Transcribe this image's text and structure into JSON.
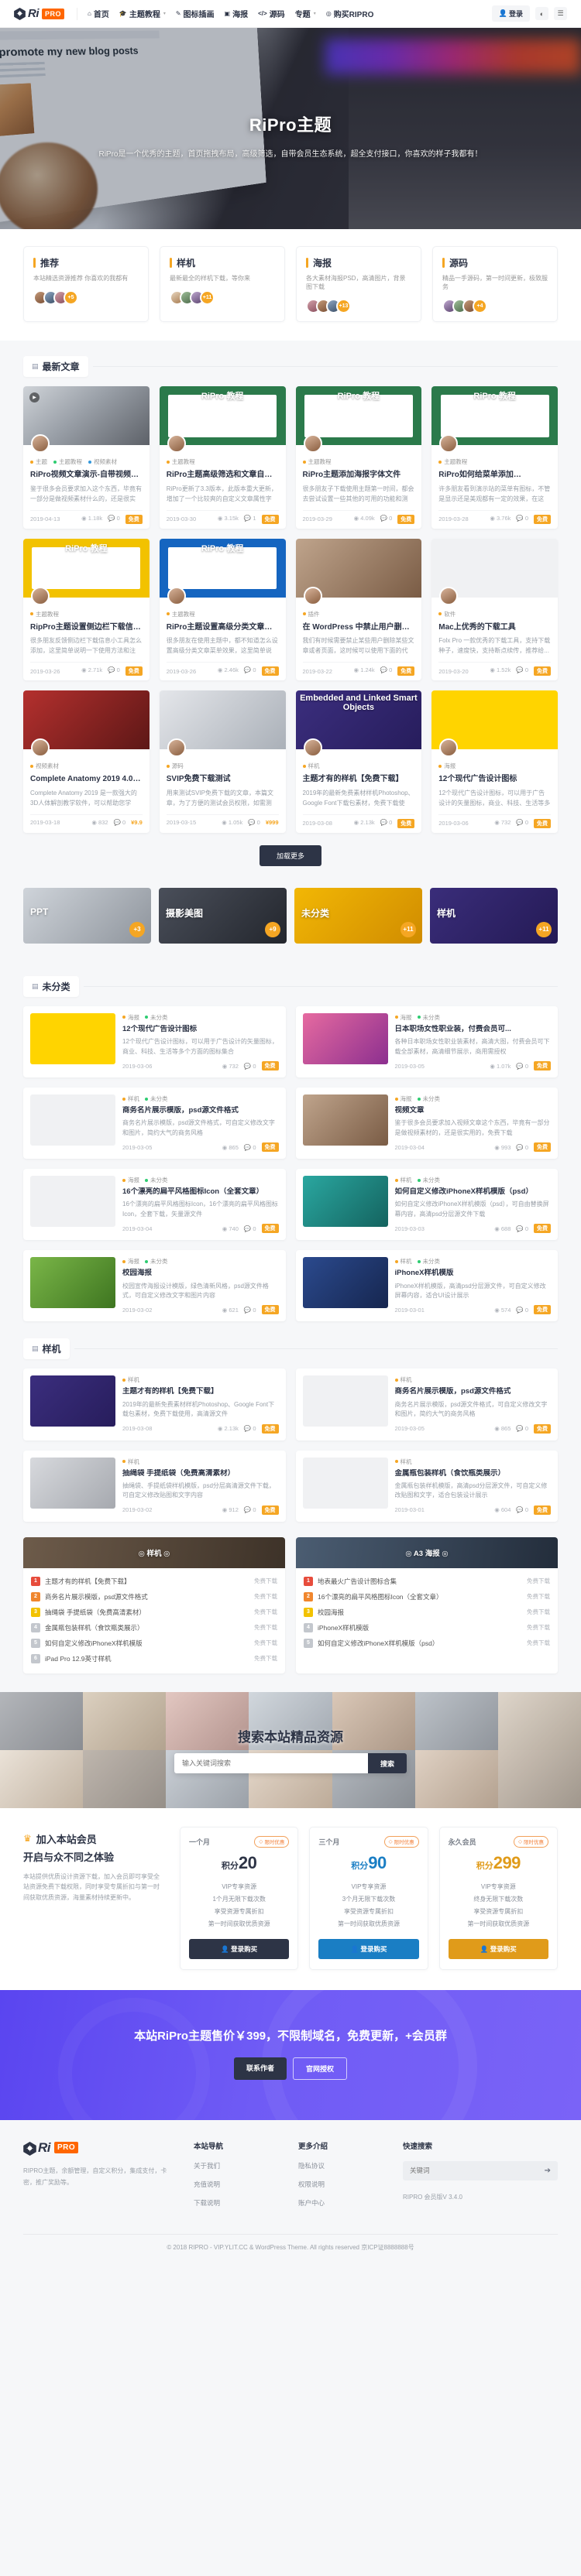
{
  "header": {
    "logo": {
      "ri": "Ri",
      "pro": "PRO",
      "icon": "diamond-logo-icon"
    },
    "nav": [
      {
        "label": "首页",
        "icon": "home-icon",
        "caret": false
      },
      {
        "label": "主题教程",
        "icon": "graduation-icon",
        "caret": true
      },
      {
        "label": "图标插画",
        "icon": "pen-icon",
        "caret": false
      },
      {
        "label": "海报",
        "icon": "image-icon",
        "caret": false
      },
      {
        "label": "源码",
        "icon": "code-icon",
        "caret": false
      },
      {
        "label": "专题",
        "icon": "",
        "caret": true
      },
      {
        "label": "购买RIPRO",
        "icon": "cart-icon",
        "caret": false
      }
    ],
    "login_label": "登录",
    "login_icon": "user-icon",
    "theme_icon": "contrast-icon",
    "menu_icon": "hamburger-icon"
  },
  "hero": {
    "title": "RiPro主题",
    "subtitle": "RiPro是一个优秀的主题，首页拖拽布局，高级筛选，自带会员生态系统，超全支付接口，你喜欢的样子我都有！",
    "screen_text": "How I promote my new blog posts"
  },
  "categories": [
    {
      "title": "推荐",
      "desc": "本站精选资源推荐 你喜欢的我都有",
      "more": "+5"
    },
    {
      "title": "样机",
      "desc": "最新最全的样机下载，等你来",
      "more": "+11"
    },
    {
      "title": "海报",
      "desc": "各大素材海报PSD，高清图片，背景图下载",
      "more": "+13"
    },
    {
      "title": "源码",
      "desc": "精品一手源码，第一时间更新，极致服务",
      "more": "+4"
    }
  ],
  "latest": {
    "section_title": "最新文章",
    "section_icon": "grid-icon",
    "loadmore_label": "加载更多",
    "posts": [
      {
        "thumb": "th-girl",
        "thumb_label": "",
        "play": true,
        "cats": [
          {
            "label": "主题",
            "color": "#f5a623"
          },
          {
            "label": "主题教程",
            "color": "#2ecc71"
          },
          {
            "label": "视频素材",
            "color": "#3498db"
          }
        ],
        "title": "RiPro视频文章演示-自带视频播放...",
        "excerpt": "鉴于很多会员要求加入这个东西，毕竟有一部分是做视频素材什么的，还是很实用...",
        "date": "2019-04-13",
        "views": "1.18k",
        "comments": "0",
        "price": "免费"
      },
      {
        "thumb": "th-ripro",
        "thumb_label": "RiPro 教程",
        "play": false,
        "cats": [
          {
            "label": "主题教程",
            "color": "#f5a623"
          }
        ],
        "title": "RiPro主题高级筛选和文章自定义属...",
        "excerpt": "RiPro更新了3.3版本，此版本重大更新，增加了一个比较爽的自定义文章属性字段...",
        "date": "2019-03-30",
        "views": "3.15k",
        "comments": "1",
        "price": "免费"
      },
      {
        "thumb": "th-ripro",
        "thumb_label": "RiPro 教程",
        "play": false,
        "cats": [
          {
            "label": "主题教程",
            "color": "#f5a623"
          }
        ],
        "title": "RiPro主题添加海报字体文件",
        "excerpt": "很多朋友子下载使用主题第一时间，都会去尝试设置一些其他的可用的功能和测试...",
        "date": "2019-03-29",
        "views": "4.09k",
        "comments": "0",
        "price": "免费"
      },
      {
        "thumb": "th-ripro",
        "thumb_label": "RiPro 教程",
        "play": false,
        "cats": [
          {
            "label": "主题教程",
            "color": "#f5a623"
          }
        ],
        "title": "RiPro如何给菜单添加fontaweso...",
        "excerpt": "许多朋友看到演示站的菜单有图标，不管是显示还是美观都有一定的效果，在这里...",
        "date": "2019-03-28",
        "views": "3.76k",
        "comments": "0",
        "price": "免费"
      },
      {
        "thumb": "th-ripro yellow",
        "thumb_label": "RiPro 教程",
        "play": false,
        "cats": [
          {
            "label": "主题教程",
            "color": "#f5a623"
          }
        ],
        "title": "RipPro主题设置侧边栏下载信息小...",
        "excerpt": "很多朋友反馈侧边栏下载信息小工具怎么添加，这里简单说明一下使用方法和注意...",
        "date": "2019-03-26",
        "views": "2.71k",
        "comments": "0",
        "price": "免费"
      },
      {
        "thumb": "th-ripro navy",
        "thumb_label": "RiPro 教程",
        "play": false,
        "cats": [
          {
            "label": "主题教程",
            "color": "#f5a623"
          }
        ],
        "title": "RiPro主题设置高级分类文章菜单",
        "excerpt": "很多朋友在使用主题中，都不知道怎么设置高级分类文章菜单效果，这里简单说明...",
        "date": "2019-03-26",
        "views": "2.46k",
        "comments": "0",
        "price": "免费"
      },
      {
        "thumb": "th-photo1",
        "thumb_label": "",
        "play": false,
        "cats": [
          {
            "label": "插件",
            "color": "#f5a623"
          }
        ],
        "title": "在 WordPress 中禁止用户删除某...",
        "excerpt": "我们有时候需要禁止某些用户删除某些文章或者页面，这时候可以使用下面的代码...",
        "date": "2019-03-22",
        "views": "1.24k",
        "comments": "0",
        "price": "免费"
      },
      {
        "thumb": "th-white",
        "thumb_label": "",
        "play": false,
        "cats": [
          {
            "label": "软件",
            "color": "#f5a623"
          }
        ],
        "title": "Mac上优秀的下载工具",
        "excerpt": "Folx Pro 一款优秀的下载工具，支持下载种子，速度快，支持断点续传，推荐给...",
        "date": "2019-03-20",
        "views": "1.52k",
        "comments": "0",
        "price": "免费"
      },
      {
        "thumb": "th-red",
        "thumb_label": "",
        "play": false,
        "cats": [
          {
            "label": "视频素材",
            "color": "#f5a623"
          }
        ],
        "title": "Complete Anatomy 2019 4.0.1 ...",
        "excerpt": "Complete Anatomy 2019 是一款强大的3D人体解剖教学软件，可以帮助您学习...",
        "date": "2019-03-18",
        "views": "832",
        "comments": "0",
        "price": "¥9.9"
      },
      {
        "thumb": "th-photo2",
        "thumb_label": "",
        "play": false,
        "cats": [
          {
            "label": "源码",
            "color": "#f5a623"
          }
        ],
        "title": "SVIP免费下载测试",
        "excerpt": "用来测试SVIP免费下载的文章，本篇文章，为了方便的测试会员权限，如需测试，请自行注册...",
        "date": "2019-03-15",
        "views": "1.05k",
        "comments": "0",
        "price": "¥999"
      },
      {
        "thumb": "th-purple",
        "thumb_label": "Embedded and Linked Smart Objects",
        "play": false,
        "cats": [
          {
            "label": "样机",
            "color": "#f5a623"
          }
        ],
        "title": "主题才有的样机【免费下载】",
        "excerpt": "2019年的最新免费素材样机Photoshop、Google Font下载包素材，免费下载使用...",
        "date": "2019-03-08",
        "views": "2.13k",
        "comments": "0",
        "price": "免费"
      },
      {
        "thumb": "th-yellowflat",
        "thumb_label": "",
        "play": false,
        "cats": [
          {
            "label": "海报",
            "color": "#f5a623"
          }
        ],
        "title": "12个现代广告设计图标",
        "excerpt": "12个现代广告设计图标，可以用于广告设计的矢量图标，商业、科技、生活等多个...",
        "date": "2019-03-06",
        "views": "732",
        "comments": "0",
        "price": "免费"
      }
    ]
  },
  "strip": [
    {
      "label": "PPT",
      "badge": "+3",
      "cls": "strip1"
    },
    {
      "label": "摄影美图",
      "badge": "+9",
      "cls": "strip2"
    },
    {
      "label": "未分类",
      "badge": "+11",
      "cls": "strip3"
    },
    {
      "label": "样机",
      "badge": "+11",
      "cls": "strip4"
    }
  ],
  "uncategorized": {
    "section_title": "未分类",
    "section_icon": "grid-icon",
    "items": [
      {
        "thumb": "th-yellowflat",
        "cats": [
          {
            "label": "海报",
            "color": "#f5a623"
          },
          {
            "label": "未分类",
            "color": "#2ecc71"
          }
        ],
        "title": "12个现代广告设计图标",
        "excerpt": "12个现代广告设计图标，可以用于广告设计的矢量图标，商业、科技、生活等多个方面的图标集合",
        "date": "2019-03-06",
        "views": "732",
        "comments": "0",
        "price": "免费"
      },
      {
        "thumb": "th-pink",
        "cats": [
          {
            "label": "海报",
            "color": "#f5a623"
          },
          {
            "label": "未分类",
            "color": "#2ecc71"
          }
        ],
        "title": "日本职场女性职业装，付费会员可...",
        "excerpt": "各种日本职场女性职业装素材，高清大图，付费会员可下载全部素材，高清细节展示，商用需授权",
        "date": "2019-03-05",
        "views": "1.07k",
        "comments": "0",
        "price": "免费"
      },
      {
        "thumb": "th-white",
        "cats": [
          {
            "label": "样机",
            "color": "#f5a623"
          },
          {
            "label": "未分类",
            "color": "#2ecc71"
          }
        ],
        "title": "商务名片展示模版，psd源文件格式",
        "excerpt": "商务名片展示模版，psd源文件格式，可自定义修改文字和图片，简约大气的商务风格",
        "date": "2019-03-05",
        "views": "865",
        "comments": "0",
        "price": "免费"
      },
      {
        "thumb": "th-photo1",
        "cats": [
          {
            "label": "海报",
            "color": "#f5a623"
          },
          {
            "label": "未分类",
            "color": "#2ecc71"
          }
        ],
        "title": "视频文章",
        "excerpt": "鉴于很多会员要求加入视频文章这个东西，毕竟有一部分是做视频素材的，还是很实用的，免费下载",
        "date": "2019-03-04",
        "views": "993",
        "comments": "0",
        "price": "免费"
      },
      {
        "thumb": "th-white",
        "cats": [
          {
            "label": "海报",
            "color": "#f5a623"
          },
          {
            "label": "未分类",
            "color": "#2ecc71"
          }
        ],
        "title": "16个漂亮的扁平风格图标Icon（全套文章）",
        "excerpt": "16个漂亮的扁平风格图标Icon，16个漂亮的扁平风格图标Icon，全套下载，矢量源文件",
        "date": "2019-03-04",
        "views": "740",
        "comments": "0",
        "price": "免费"
      },
      {
        "thumb": "th-teal",
        "cats": [
          {
            "label": "样机",
            "color": "#f5a623"
          },
          {
            "label": "未分类",
            "color": "#2ecc71"
          }
        ],
        "title": "如何自定义修改iPhoneX样机模版（psd）",
        "excerpt": "如何自定义修改iPhoneX样机模版（psd），可自由替换屏幕内容，高清psd分层源文件下载",
        "date": "2019-03-03",
        "views": "688",
        "comments": "0",
        "price": "免费"
      },
      {
        "thumb": "th-green2",
        "cats": [
          {
            "label": "海报",
            "color": "#f5a623"
          },
          {
            "label": "未分类",
            "color": "#2ecc71"
          }
        ],
        "title": "校园海报",
        "excerpt": "校园宣传海报设计模版，绿色清新风格，psd源文件格式，可自定义修改文字和图片内容",
        "date": "2019-03-02",
        "views": "621",
        "comments": "0",
        "price": "免费"
      },
      {
        "thumb": "th-blue2",
        "cats": [
          {
            "label": "样机",
            "color": "#f5a623"
          },
          {
            "label": "未分类",
            "color": "#2ecc71"
          }
        ],
        "title": "iPhoneX样机模版",
        "excerpt": "iPhoneX样机模版，高清psd分层源文件，可自定义修改屏幕内容，适合UI设计展示",
        "date": "2019-03-01",
        "views": "574",
        "comments": "0",
        "price": "免费"
      }
    ]
  },
  "mockups": {
    "section_title": "样机",
    "section_icon": "grid-icon",
    "items": [
      {
        "thumb": "th-purple",
        "cats": [
          {
            "label": "样机",
            "color": "#f5a623"
          }
        ],
        "title": "主题才有的样机【免费下载】",
        "excerpt": "2019年的最新免费素材样机Photoshop、Google Font下载包素材，免费下载使用，高清源文件",
        "date": "2019-03-08",
        "views": "2.13k",
        "comments": "0",
        "price": "免费"
      },
      {
        "thumb": "th-white",
        "cats": [
          {
            "label": "样机",
            "color": "#f5a623"
          }
        ],
        "title": "商务名片展示模版，psd源文件格式",
        "excerpt": "商务名片展示模版，psd源文件格式，可自定义修改文字和图片，简约大气的商务风格",
        "date": "2019-03-05",
        "views": "865",
        "comments": "0",
        "price": "免费"
      },
      {
        "thumb": "th-grey",
        "cats": [
          {
            "label": "样机",
            "color": "#f5a623"
          }
        ],
        "title": "抽绳袋 手提纸袋（免费高清素材）",
        "excerpt": "抽绳袋、手提纸袋样机模版，psd分层高清源文件下载，可自定义修改贴图和文字内容",
        "date": "2019-03-02",
        "views": "912",
        "comments": "0",
        "price": "免费"
      },
      {
        "thumb": "th-white",
        "cats": [
          {
            "label": "样机",
            "color": "#f5a623"
          }
        ],
        "title": "金属瓶包装样机（食饮瓶类展示）",
        "excerpt": "金属瓶包装样机模版，高清psd分层源文件，可自定义修改贴图和文字，适合包装设计展示",
        "date": "2019-03-01",
        "views": "604",
        "comments": "0",
        "price": "免费"
      }
    ]
  },
  "ranks": [
    {
      "title": "◎ 样机 ◎",
      "head_cls": "rh1",
      "items": [
        {
          "n": "1",
          "name": "主题才有的样机【免费下载】",
          "val": "免费下载"
        },
        {
          "n": "2",
          "name": "商务名片展示模版，psd源文件格式",
          "val": "免费下载"
        },
        {
          "n": "3",
          "name": "抽绳袋 手提纸袋（免费高清素材）",
          "val": "免费下载"
        },
        {
          "n": "4",
          "name": "金属瓶包装样机（食饮瓶类展示）",
          "val": "免费下载"
        },
        {
          "n": "5",
          "name": "如何自定义修改iPhoneX样机模版",
          "val": "免费下载"
        },
        {
          "n": "6",
          "name": "iPad Pro 12.9英寸样机",
          "val": "免费下载"
        }
      ]
    },
    {
      "title": "◎ A3 海报 ◎",
      "head_cls": "rh2",
      "items": [
        {
          "n": "1",
          "name": "地表最火广告设计图标合集",
          "val": "免费下载"
        },
        {
          "n": "2",
          "name": "16个漂亮的扁平风格图标Icon（全套文章）",
          "val": "免费下载"
        },
        {
          "n": "3",
          "name": "校园海报",
          "val": "免费下载"
        },
        {
          "n": "4",
          "name": "iPhoneX样机模版",
          "val": "免费下载"
        },
        {
          "n": "5",
          "name": "如何自定义修改iPhoneX样机模版（psd）",
          "val": "免费下载"
        }
      ]
    }
  ],
  "search_banner": {
    "title": "搜索本站精品资源",
    "placeholder": "输入关键词搜索",
    "button": "搜索"
  },
  "vip": {
    "title_icon": "crown-icon",
    "title": "加入本站会员",
    "subtitle": "开启与众不同之体验",
    "desc": "本站提供优质设计资源下载，加入会员即可享受全站资源免费下载权限，同时享受专属折扣与第一时间获取优质资源，海量素材持续更新中。",
    "plans": [
      {
        "name": "一个月",
        "promo": "限时优惠",
        "unit": "积分",
        "amount": "20",
        "features": [
          "VIP专享资源",
          "1个月无限下载次数",
          "享受资源专属折扣",
          "第一时间获取优质资源"
        ],
        "btn": "登录购买",
        "btn_cls": "vb1",
        "price_cls": "c1"
      },
      {
        "name": "三个月",
        "promo": "限时优惠",
        "unit": "积分",
        "amount": "90",
        "features": [
          "VIP专享资源",
          "3个月无限下载次数",
          "享受资源专属折扣",
          "第一时间获取优质资源"
        ],
        "btn": "登录购买",
        "btn_cls": "vb2",
        "price_cls": "c2"
      },
      {
        "name": "永久会员",
        "promo": "限时优惠",
        "unit": "积分",
        "amount": "299",
        "features": [
          "VIP专享资源",
          "终身无限下载次数",
          "享受资源专属折扣",
          "第一时间获取优质资源"
        ],
        "btn": "登录购买",
        "btn_cls": "vb3",
        "price_cls": "c3"
      }
    ]
  },
  "cta": {
    "title": "本站RiPro主题售价￥399，不限制域名，免费更新，+会员群",
    "btn1": "联系作者",
    "btn2": "官网授权"
  },
  "footer": {
    "logo": {
      "ri": "Ri",
      "pro": "PRO"
    },
    "desc": "RIPRO主题，余额管理，自定义积分，集成支付，卡密，推广奖励等。",
    "cols": [
      {
        "title": "本站导航",
        "links": [
          "关于我们",
          "充值说明",
          "下载说明"
        ]
      },
      {
        "title": "更多介绍",
        "links": [
          "隐私协议",
          "权限说明",
          "账户中心"
        ]
      }
    ],
    "search_title": "快速搜索",
    "search_placeholder": "关键词",
    "search_icon": "arrow-right-icon",
    "version": "RIPRO 会员版V 3.4.0",
    "copyright": "© 2018 RIPRO - VIP.YLIT.CC & WordPress Theme. All rights reserved 京ICP证8888888号"
  }
}
